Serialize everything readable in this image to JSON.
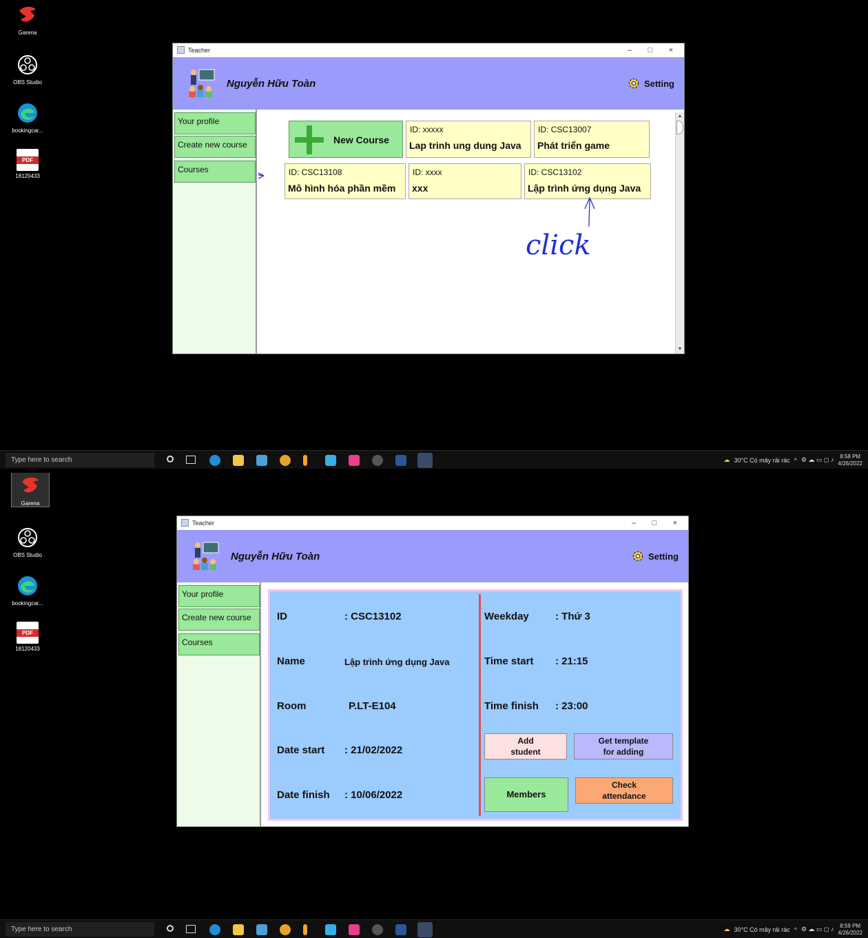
{
  "desktop": {
    "icons": [
      {
        "label": "Garena"
      },
      {
        "label": "OBS Studio"
      },
      {
        "label": "bookingcar..."
      },
      {
        "label": "18120433"
      }
    ],
    "pdf_badge": "PDF"
  },
  "taskbar": {
    "search_placeholder": "Type here to search",
    "weather": "30°C  Có mây rải rác",
    "time1": "8:58 PM",
    "time2": "8:59 PM",
    "date": "4/26/2022"
  },
  "window": {
    "title": "Teacher",
    "minimize": "–",
    "maximize": "□",
    "close": "×"
  },
  "header": {
    "user_name": "Nguyễn Hữu Toàn",
    "setting_label": "Setting"
  },
  "sidebar": {
    "items": [
      {
        "label": "Your profile"
      },
      {
        "label": "Create new course"
      },
      {
        "label": "Courses"
      }
    ]
  },
  "courses_screen": {
    "new_course_label": "New Course",
    "courses": [
      {
        "id": "ID: xxxxx",
        "name": "Lap trinh ung dung Java"
      },
      {
        "id": "ID: CSC13007",
        "name": "Phát triển game"
      },
      {
        "id": "ID: CSC13108",
        "name": "Mô hình hóa phần mềm"
      },
      {
        "id": "ID: xxxx",
        "name": "xxx"
      },
      {
        "id": "ID: CSC13102",
        "name": "Lập trình ứng dụng Java"
      }
    ],
    "annotation": "click"
  },
  "course_detail": {
    "left": [
      {
        "label": "ID",
        "value": ": CSC13102"
      },
      {
        "label": "Name",
        "value": "Lập trình ứng dụng Java"
      },
      {
        "label": "Room",
        "value": "P.LT-E104"
      },
      {
        "label": "Date start",
        "value": ": 21/02/2022"
      },
      {
        "label": "Date finish",
        "value": ": 10/06/2022"
      }
    ],
    "right": [
      {
        "label": "Weekday",
        "value": ": Thứ 3"
      },
      {
        "label": "Time start",
        "value": ": 21:15"
      },
      {
        "label": "Time finish",
        "value": ": 23:00"
      }
    ],
    "buttons": {
      "add_student": [
        "Add",
        "student"
      ],
      "get_template": [
        "Get template",
        "for adding"
      ],
      "members": "Members",
      "check_attendance": [
        "Check",
        "attendance"
      ]
    },
    "colors": {
      "panel": "#9ccbfe",
      "add_student": "#fde0e0",
      "get_template": "#b9b9fb",
      "members": "#9ae89a",
      "check_attendance": "#fba872"
    }
  },
  "theme": {
    "header": "#9b9bfb",
    "sidebar_btn": "#9ae89a",
    "sidebar_bg": "#edfbe9",
    "course_card": "#ffffc6"
  }
}
